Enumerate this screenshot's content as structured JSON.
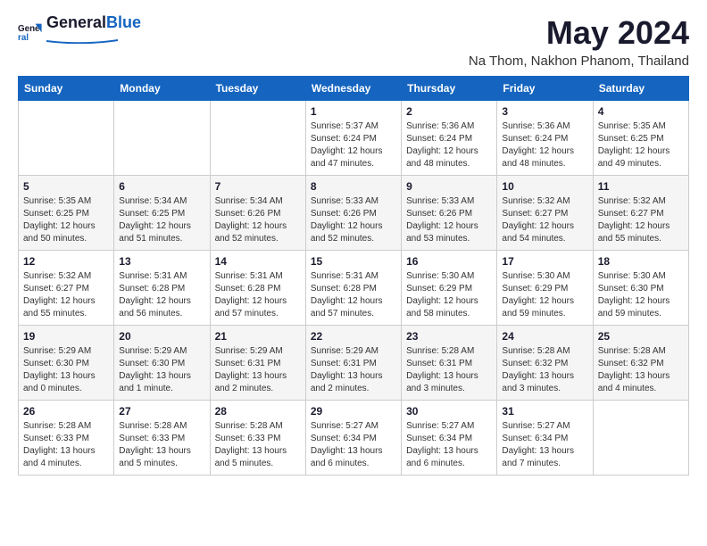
{
  "header": {
    "logo_general": "General",
    "logo_blue": "Blue",
    "title": "May 2024",
    "subtitle": "Na Thom, Nakhon Phanom, Thailand"
  },
  "weekdays": [
    "Sunday",
    "Monday",
    "Tuesday",
    "Wednesday",
    "Thursday",
    "Friday",
    "Saturday"
  ],
  "weeks": [
    [
      {
        "day": "",
        "sunrise": "",
        "sunset": "",
        "daylight": ""
      },
      {
        "day": "",
        "sunrise": "",
        "sunset": "",
        "daylight": ""
      },
      {
        "day": "",
        "sunrise": "",
        "sunset": "",
        "daylight": ""
      },
      {
        "day": "1",
        "sunrise": "Sunrise: 5:37 AM",
        "sunset": "Sunset: 6:24 PM",
        "daylight": "Daylight: 12 hours and 47 minutes."
      },
      {
        "day": "2",
        "sunrise": "Sunrise: 5:36 AM",
        "sunset": "Sunset: 6:24 PM",
        "daylight": "Daylight: 12 hours and 48 minutes."
      },
      {
        "day": "3",
        "sunrise": "Sunrise: 5:36 AM",
        "sunset": "Sunset: 6:24 PM",
        "daylight": "Daylight: 12 hours and 48 minutes."
      },
      {
        "day": "4",
        "sunrise": "Sunrise: 5:35 AM",
        "sunset": "Sunset: 6:25 PM",
        "daylight": "Daylight: 12 hours and 49 minutes."
      }
    ],
    [
      {
        "day": "5",
        "sunrise": "Sunrise: 5:35 AM",
        "sunset": "Sunset: 6:25 PM",
        "daylight": "Daylight: 12 hours and 50 minutes."
      },
      {
        "day": "6",
        "sunrise": "Sunrise: 5:34 AM",
        "sunset": "Sunset: 6:25 PM",
        "daylight": "Daylight: 12 hours and 51 minutes."
      },
      {
        "day": "7",
        "sunrise": "Sunrise: 5:34 AM",
        "sunset": "Sunset: 6:26 PM",
        "daylight": "Daylight: 12 hours and 52 minutes."
      },
      {
        "day": "8",
        "sunrise": "Sunrise: 5:33 AM",
        "sunset": "Sunset: 6:26 PM",
        "daylight": "Daylight: 12 hours and 52 minutes."
      },
      {
        "day": "9",
        "sunrise": "Sunrise: 5:33 AM",
        "sunset": "Sunset: 6:26 PM",
        "daylight": "Daylight: 12 hours and 53 minutes."
      },
      {
        "day": "10",
        "sunrise": "Sunrise: 5:32 AM",
        "sunset": "Sunset: 6:27 PM",
        "daylight": "Daylight: 12 hours and 54 minutes."
      },
      {
        "day": "11",
        "sunrise": "Sunrise: 5:32 AM",
        "sunset": "Sunset: 6:27 PM",
        "daylight": "Daylight: 12 hours and 55 minutes."
      }
    ],
    [
      {
        "day": "12",
        "sunrise": "Sunrise: 5:32 AM",
        "sunset": "Sunset: 6:27 PM",
        "daylight": "Daylight: 12 hours and 55 minutes."
      },
      {
        "day": "13",
        "sunrise": "Sunrise: 5:31 AM",
        "sunset": "Sunset: 6:28 PM",
        "daylight": "Daylight: 12 hours and 56 minutes."
      },
      {
        "day": "14",
        "sunrise": "Sunrise: 5:31 AM",
        "sunset": "Sunset: 6:28 PM",
        "daylight": "Daylight: 12 hours and 57 minutes."
      },
      {
        "day": "15",
        "sunrise": "Sunrise: 5:31 AM",
        "sunset": "Sunset: 6:28 PM",
        "daylight": "Daylight: 12 hours and 57 minutes."
      },
      {
        "day": "16",
        "sunrise": "Sunrise: 5:30 AM",
        "sunset": "Sunset: 6:29 PM",
        "daylight": "Daylight: 12 hours and 58 minutes."
      },
      {
        "day": "17",
        "sunrise": "Sunrise: 5:30 AM",
        "sunset": "Sunset: 6:29 PM",
        "daylight": "Daylight: 12 hours and 59 minutes."
      },
      {
        "day": "18",
        "sunrise": "Sunrise: 5:30 AM",
        "sunset": "Sunset: 6:30 PM",
        "daylight": "Daylight: 12 hours and 59 minutes."
      }
    ],
    [
      {
        "day": "19",
        "sunrise": "Sunrise: 5:29 AM",
        "sunset": "Sunset: 6:30 PM",
        "daylight": "Daylight: 13 hours and 0 minutes."
      },
      {
        "day": "20",
        "sunrise": "Sunrise: 5:29 AM",
        "sunset": "Sunset: 6:30 PM",
        "daylight": "Daylight: 13 hours and 1 minute."
      },
      {
        "day": "21",
        "sunrise": "Sunrise: 5:29 AM",
        "sunset": "Sunset: 6:31 PM",
        "daylight": "Daylight: 13 hours and 2 minutes."
      },
      {
        "day": "22",
        "sunrise": "Sunrise: 5:29 AM",
        "sunset": "Sunset: 6:31 PM",
        "daylight": "Daylight: 13 hours and 2 minutes."
      },
      {
        "day": "23",
        "sunrise": "Sunrise: 5:28 AM",
        "sunset": "Sunset: 6:31 PM",
        "daylight": "Daylight: 13 hours and 3 minutes."
      },
      {
        "day": "24",
        "sunrise": "Sunrise: 5:28 AM",
        "sunset": "Sunset: 6:32 PM",
        "daylight": "Daylight: 13 hours and 3 minutes."
      },
      {
        "day": "25",
        "sunrise": "Sunrise: 5:28 AM",
        "sunset": "Sunset: 6:32 PM",
        "daylight": "Daylight: 13 hours and 4 minutes."
      }
    ],
    [
      {
        "day": "26",
        "sunrise": "Sunrise: 5:28 AM",
        "sunset": "Sunset: 6:33 PM",
        "daylight": "Daylight: 13 hours and 4 minutes."
      },
      {
        "day": "27",
        "sunrise": "Sunrise: 5:28 AM",
        "sunset": "Sunset: 6:33 PM",
        "daylight": "Daylight: 13 hours and 5 minutes."
      },
      {
        "day": "28",
        "sunrise": "Sunrise: 5:28 AM",
        "sunset": "Sunset: 6:33 PM",
        "daylight": "Daylight: 13 hours and 5 minutes."
      },
      {
        "day": "29",
        "sunrise": "Sunrise: 5:27 AM",
        "sunset": "Sunset: 6:34 PM",
        "daylight": "Daylight: 13 hours and 6 minutes."
      },
      {
        "day": "30",
        "sunrise": "Sunrise: 5:27 AM",
        "sunset": "Sunset: 6:34 PM",
        "daylight": "Daylight: 13 hours and 6 minutes."
      },
      {
        "day": "31",
        "sunrise": "Sunrise: 5:27 AM",
        "sunset": "Sunset: 6:34 PM",
        "daylight": "Daylight: 13 hours and 7 minutes."
      },
      {
        "day": "",
        "sunrise": "",
        "sunset": "",
        "daylight": ""
      }
    ]
  ]
}
